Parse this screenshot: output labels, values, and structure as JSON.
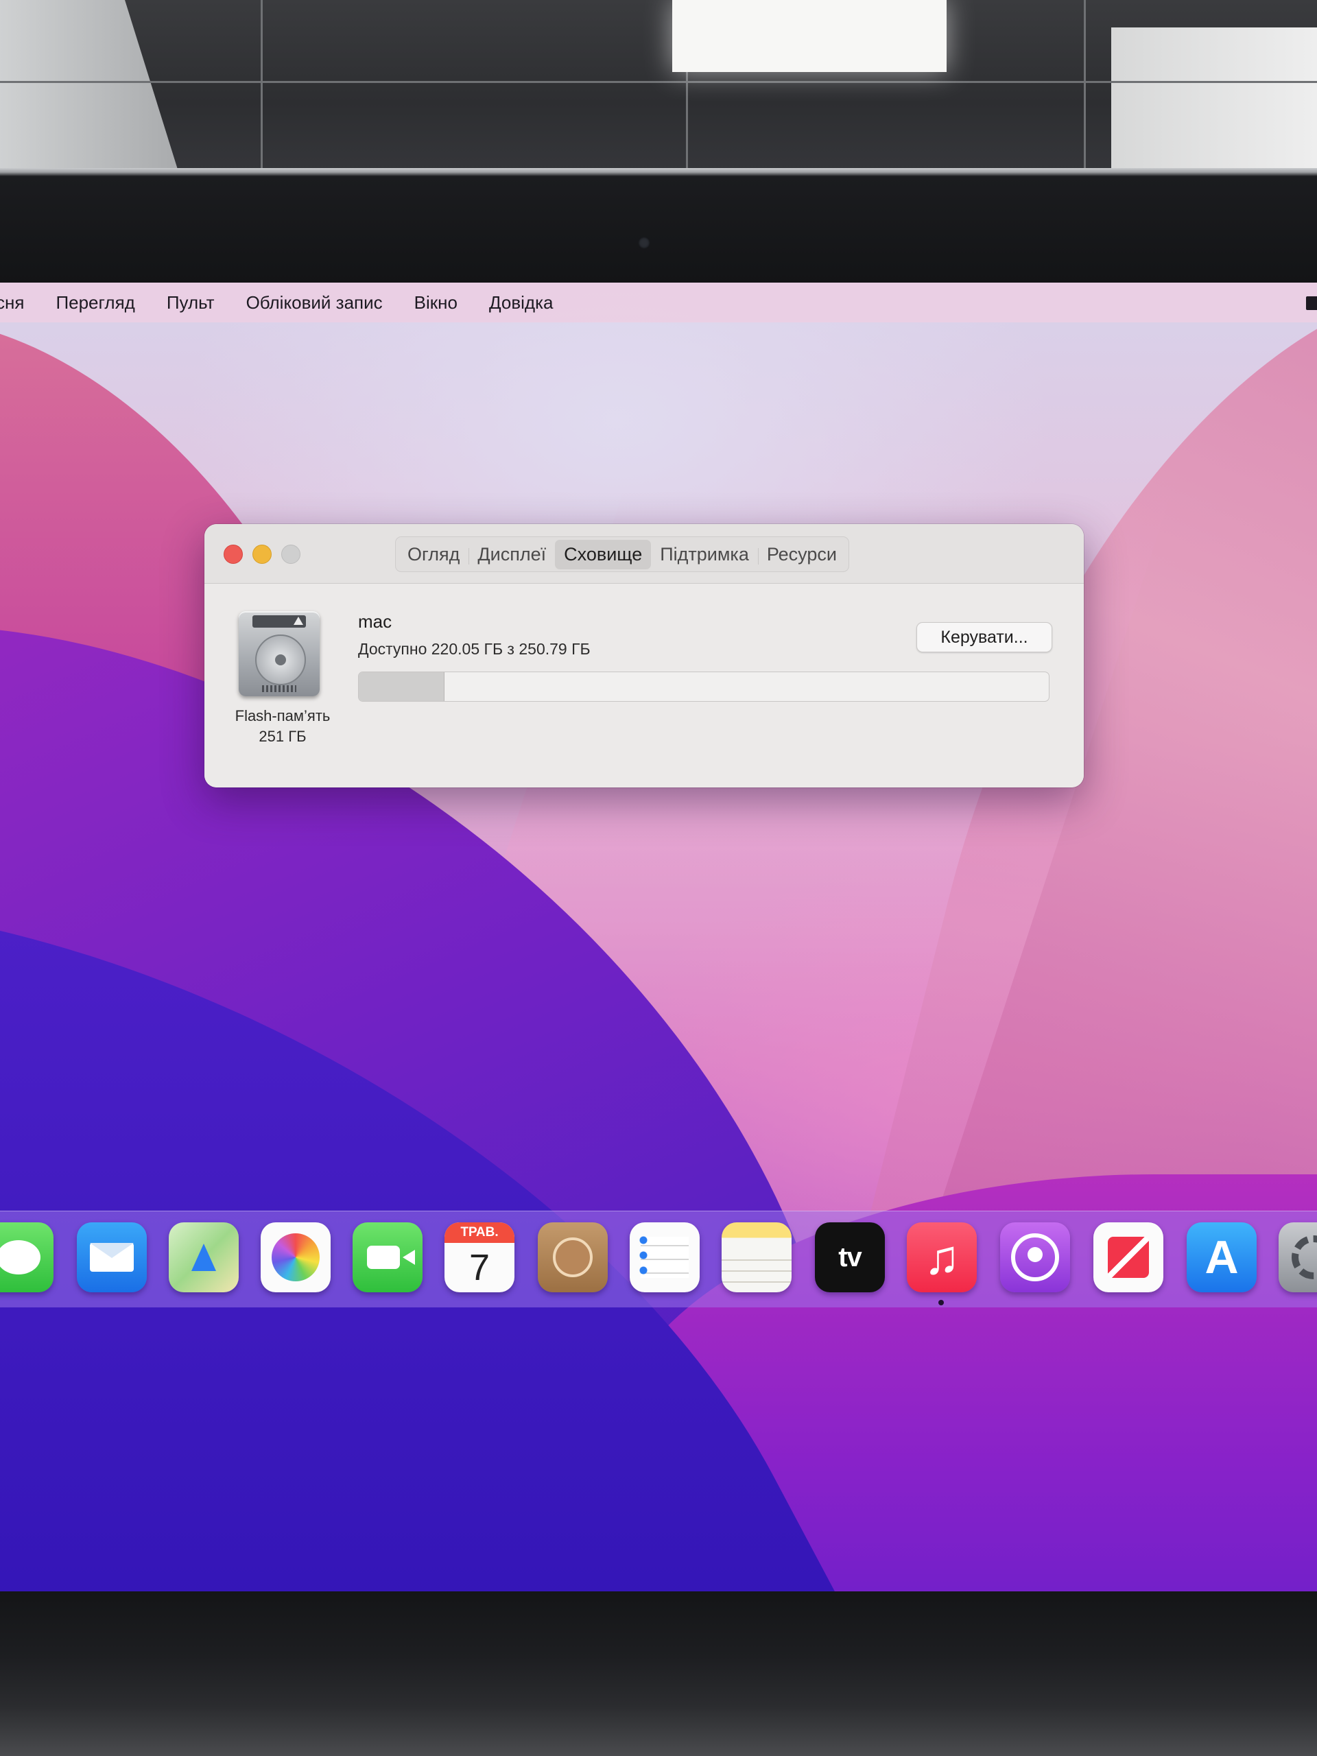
{
  "menubar": {
    "items": [
      "сня",
      "Перегляд",
      "Пульт",
      "Обліковий запис",
      "Вікно",
      "Довідка"
    ]
  },
  "window": {
    "tabs": [
      {
        "label": "Огляд",
        "active": false
      },
      {
        "label": "Дисплеї",
        "active": false
      },
      {
        "label": "Сховище",
        "active": true
      },
      {
        "label": "Підтримка",
        "active": false
      },
      {
        "label": "Ресурси",
        "active": false
      }
    ],
    "disk": {
      "caption_line1": "Flash-пам’ять",
      "caption_line2": "251 ГБ"
    },
    "volume": {
      "name": "mac",
      "available_text": "Доступно 220.05 ГБ з 250.79 ГБ",
      "used_fraction": 0.123
    },
    "manage_button": "Керувати..."
  },
  "dock": {
    "calendar_month": "ТРАВ.",
    "calendar_day": "7",
    "tv_label": "tv",
    "icons": [
      "messages-icon",
      "mail-icon",
      "maps-icon",
      "photos-icon",
      "facetime-icon",
      "calendar-icon",
      "contacts-icon",
      "reminders-icon",
      "notes-icon",
      "apple-tv-icon",
      "music-icon",
      "podcasts-icon",
      "news-icon",
      "app-store-icon",
      "system-preferences-icon"
    ]
  },
  "colors": {
    "close": "#ee5b55",
    "minimize": "#f0b73b",
    "zoom": "#cfcfcf"
  }
}
